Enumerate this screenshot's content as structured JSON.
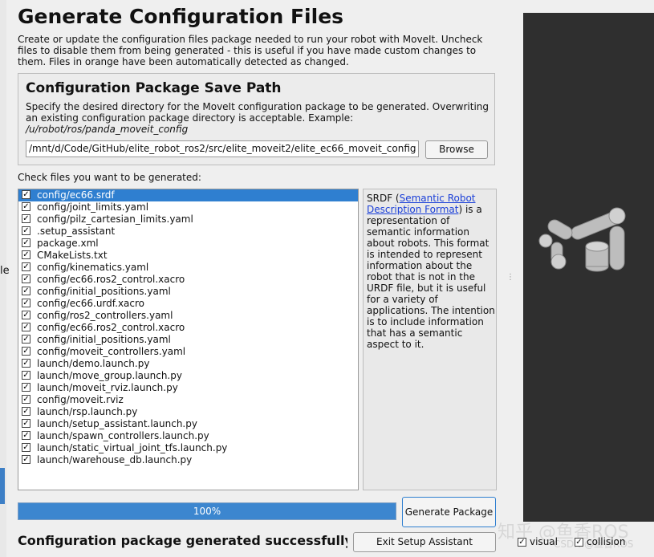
{
  "page": {
    "title": "Generate Configuration Files",
    "description": "Create or update the configuration files package needed to run your robot with MoveIt. Uncheck files to disable them from being generated - this is useful if you have made custom changes to them. Files in orange have been automatically detected as changed."
  },
  "save_path": {
    "title": "Configuration Package Save Path",
    "description": "Specify the desired directory for the MoveIt configuration package to be generated. Overwriting an existing configuration package directory is acceptable. Example: ",
    "example": "/u/robot/ros/panda_moveit_config",
    "value": "/mnt/d/Code/GitHub/elite_robot_ros2/src/elite_moveit2/elite_ec66_moveit_config",
    "browse_label": "Browse"
  },
  "files_label": "Check files you want to be generated:",
  "files": [
    {
      "name": "config/ec66.srdf",
      "checked": true,
      "selected": true
    },
    {
      "name": "config/joint_limits.yaml",
      "checked": true
    },
    {
      "name": "config/pilz_cartesian_limits.yaml",
      "checked": true
    },
    {
      "name": ".setup_assistant",
      "checked": true
    },
    {
      "name": "package.xml",
      "checked": true
    },
    {
      "name": "CMakeLists.txt",
      "checked": true
    },
    {
      "name": "config/kinematics.yaml",
      "checked": true
    },
    {
      "name": "config/ec66.ros2_control.xacro",
      "checked": true
    },
    {
      "name": "config/initial_positions.yaml",
      "checked": true
    },
    {
      "name": "config/ec66.urdf.xacro",
      "checked": true
    },
    {
      "name": "config/ros2_controllers.yaml",
      "checked": true
    },
    {
      "name": "config/ec66.ros2_control.xacro",
      "checked": true
    },
    {
      "name": "config/initial_positions.yaml",
      "checked": true
    },
    {
      "name": "config/moveit_controllers.yaml",
      "checked": true
    },
    {
      "name": "launch/demo.launch.py",
      "checked": true
    },
    {
      "name": "launch/move_group.launch.py",
      "checked": true
    },
    {
      "name": "launch/moveit_rviz.launch.py",
      "checked": true
    },
    {
      "name": "config/moveit.rviz",
      "checked": true
    },
    {
      "name": "launch/rsp.launch.py",
      "checked": true
    },
    {
      "name": "launch/setup_assistant.launch.py",
      "checked": true
    },
    {
      "name": "launch/spawn_controllers.launch.py",
      "checked": true
    },
    {
      "name": "launch/static_virtual_joint_tfs.launch.py",
      "checked": true
    },
    {
      "name": "launch/warehouse_db.launch.py",
      "checked": true
    }
  ],
  "info": {
    "prefix": "SRDF (",
    "link": "Semantic Robot Description Format",
    "suffix": ") is a representation of semantic information about robots. This format is intended to represent information about the robot that is not in the URDF file, but it is useful for a variety of applications. The intention is to include information that has a semantic aspect to it."
  },
  "progress": {
    "value": 100,
    "label": "100%"
  },
  "generate_button": "Generate Package",
  "status_text": "Configuration package generated successfully!",
  "exit_button": "Exit Setup Assistant",
  "viewer": {
    "visual_label": "visual",
    "collision_label": "collision",
    "visual_checked": true,
    "collision_checked": true
  },
  "watermark": "知乎 @鱼香ROS",
  "watermark2": "CSDN @鱼香ROS",
  "colors": {
    "accent": "#2f7fd0",
    "viewer_bg": "#2f2f2f",
    "progress": "#3c86cf"
  }
}
